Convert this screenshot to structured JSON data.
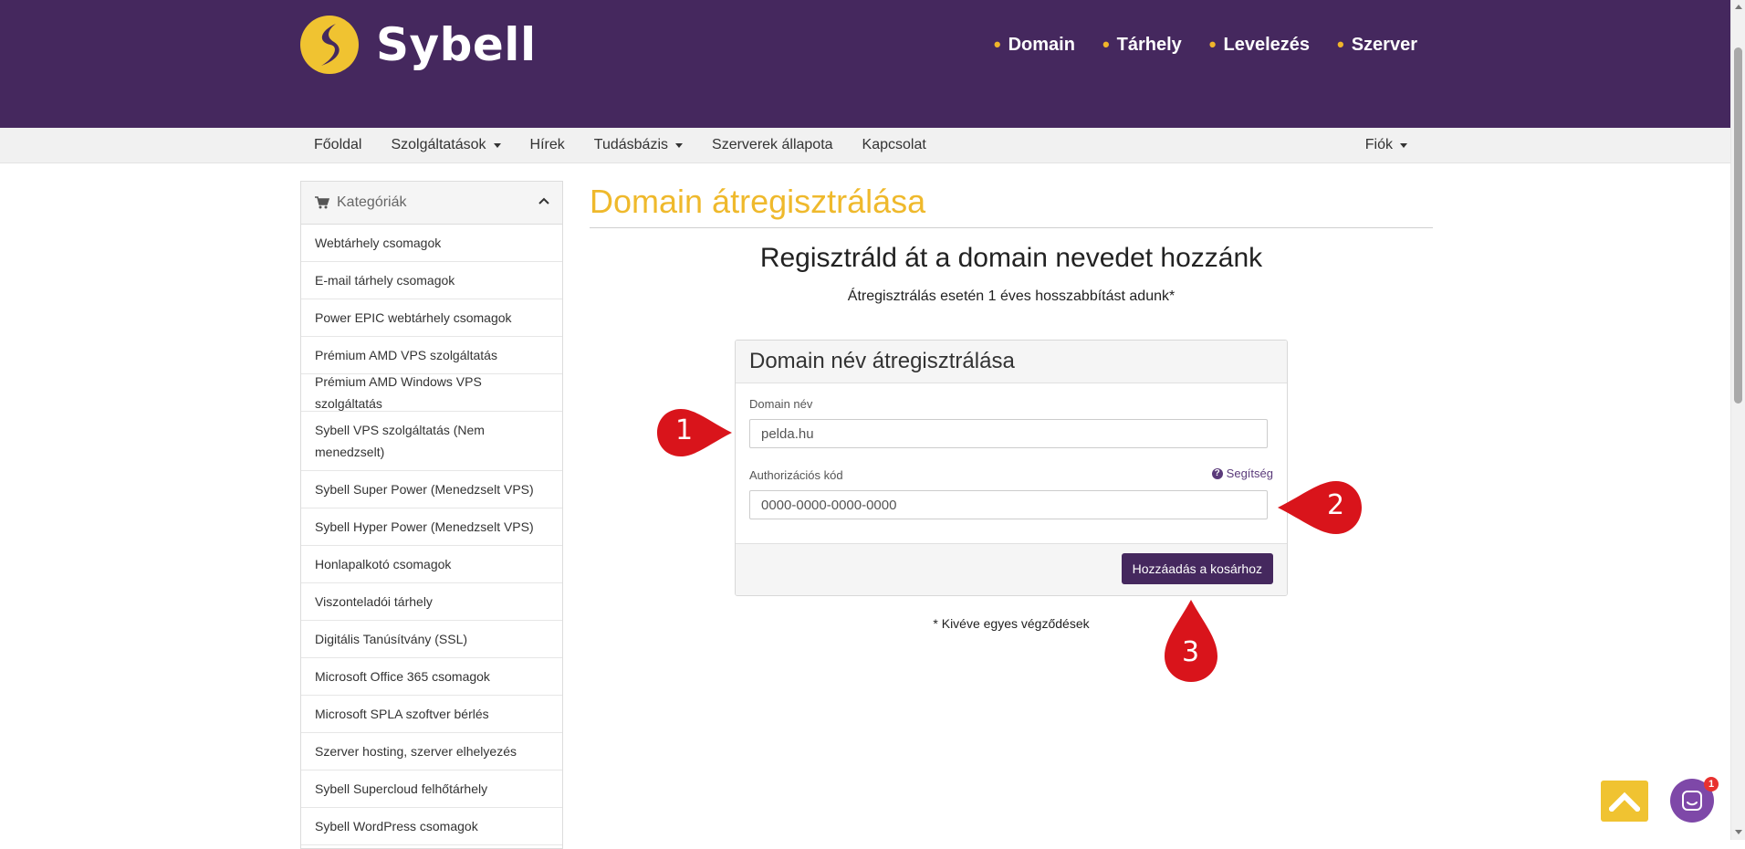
{
  "brand": {
    "name": "Sybell",
    "accent": "#efb92c",
    "primary": "#45285e"
  },
  "topnav": [
    {
      "label": "Domain"
    },
    {
      "label": "Tárhely"
    },
    {
      "label": "Levelezés"
    },
    {
      "label": "Szerver"
    }
  ],
  "subnav": {
    "items": [
      {
        "label": "Főoldal"
      },
      {
        "label": "Szolgáltatások"
      },
      {
        "label": "Hírek"
      },
      {
        "label": "Tudásbázis"
      },
      {
        "label": "Szerverek állapota"
      },
      {
        "label": "Kapcsolat"
      }
    ],
    "account": "Fiók"
  },
  "sidebar": {
    "title": "Kategóriák",
    "items": [
      "Webtárhely csomagok",
      "E-mail tárhely csomagok",
      "Power EPIC webtárhely csomagok",
      "Prémium AMD VPS szolgáltatás",
      "Prémium AMD Windows VPS szolgáltatás",
      "Sybell VPS szolgáltatás (Nem menedzselt)",
      "Sybell Super Power (Menedzselt VPS)",
      "Sybell Hyper Power (Menedzselt VPS)",
      "Honlapalkotó csomagok",
      "Viszonteladói tárhely",
      "Digitális Tanúsítvány (SSL)",
      "Microsoft Office 365 csomagok",
      "Microsoft SPLA szoftver bérlés",
      "Szerver hosting, szerver elhelyezés",
      "Sybell Supercloud felhőtárhely",
      "Sybell WordPress csomagok"
    ]
  },
  "main": {
    "title": "Domain átregisztrálása",
    "headline": "Regisztráld át a domain nevedet hozzánk",
    "subline": "Átregisztrálás esetén 1 éves hosszabbítást adunk*",
    "footnote": "* Kivéve egyes végződések"
  },
  "form": {
    "heading": "Domain név átregisztrálása",
    "domain_label": "Domain név",
    "domain_placeholder": "pelda.hu",
    "auth_label": "Authorizációs kód",
    "auth_placeholder": "0000-0000-0000-0000",
    "help_label": "Segítség",
    "submit_label": "Hozzáadás a kosárhoz"
  },
  "markers": [
    "1",
    "2",
    "3"
  ],
  "chat": {
    "badge": "1"
  },
  "icons": [
    "sybell-logo-icon",
    "cart-icon",
    "chevron-up-icon",
    "question-icon",
    "arrow-up-icon",
    "chat-icon"
  ]
}
